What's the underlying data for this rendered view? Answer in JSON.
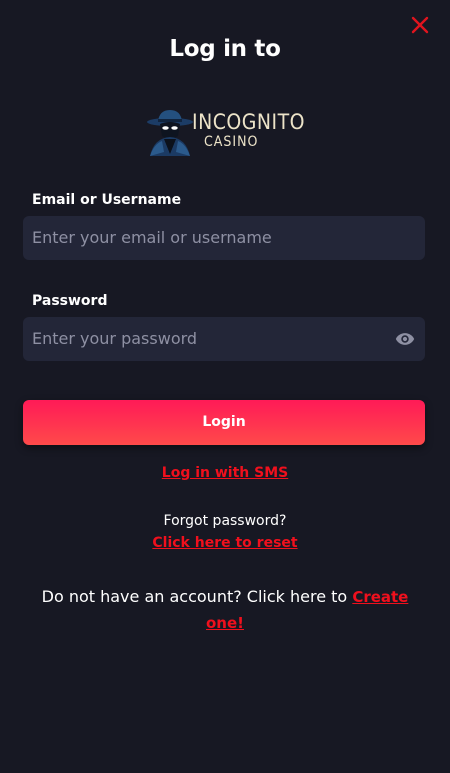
{
  "title": "Log in to",
  "logo": {
    "line1": "INCOGNITO",
    "line2": "CASINO"
  },
  "email": {
    "label": "Email or Username",
    "placeholder": "Enter your email or username"
  },
  "password": {
    "label": "Password",
    "placeholder": "Enter your password"
  },
  "login_button": "Login",
  "sms_link": "Log in with SMS",
  "forgot_text": "Forgot password?",
  "reset_link": "Click here to reset",
  "signup_text": "Do not have an account? Click here to ",
  "signup_link": "Create one!",
  "colors": {
    "background": "#171823",
    "input_bg": "#232638",
    "accent": "#ff1a57",
    "link": "#f0101d",
    "close": "#e0141e"
  },
  "icons": {
    "close": "close-icon",
    "show_password": "eye-icon"
  }
}
